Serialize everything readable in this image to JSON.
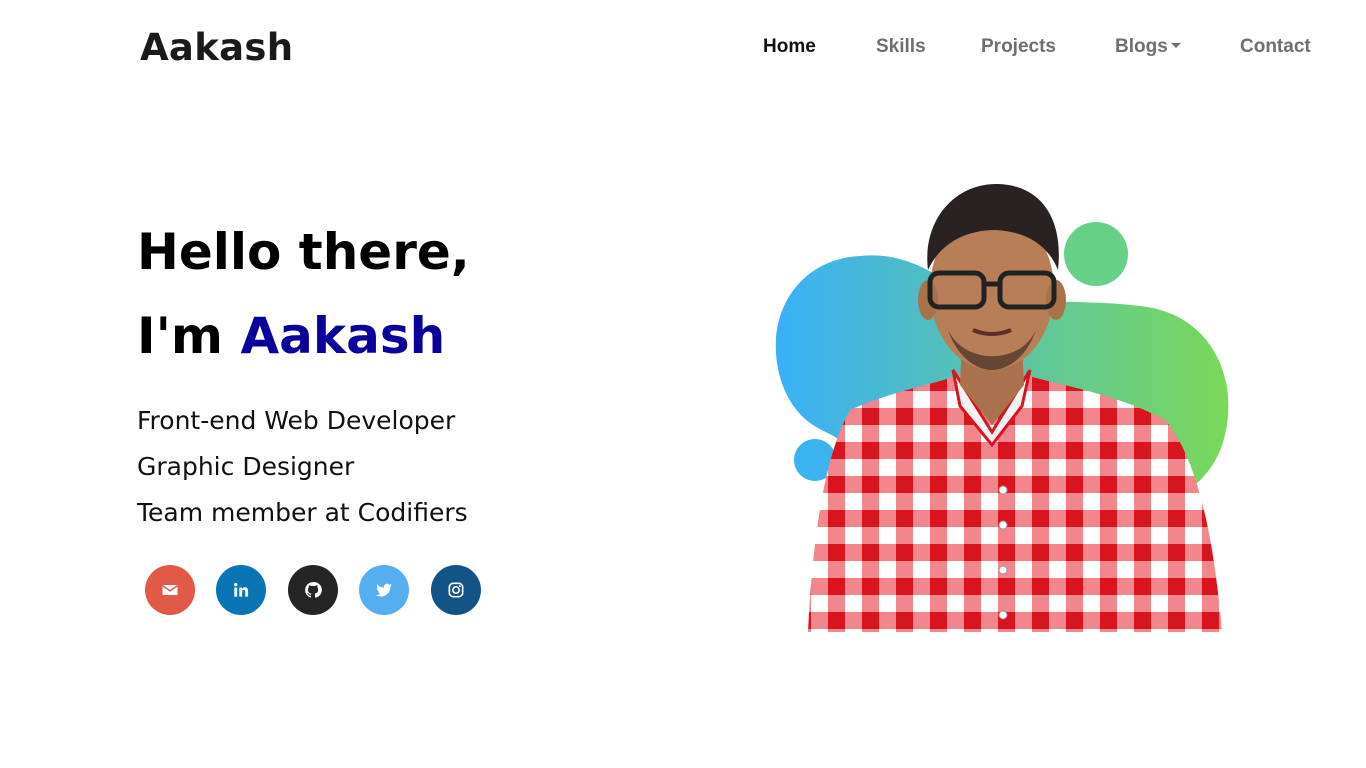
{
  "brand": "Aakash",
  "nav": {
    "items": [
      {
        "label": "Home",
        "active": true
      },
      {
        "label": "Skills"
      },
      {
        "label": "Projects"
      },
      {
        "label": "Blogs",
        "dropdown": true
      },
      {
        "label": "Contact"
      }
    ]
  },
  "hero": {
    "greeting": "Hello there,",
    "intro_prefix": "I'm",
    "name": "Aakash",
    "roles": [
      "Front-end Web Developer",
      "Graphic Designer",
      "Team member at Codifiers"
    ]
  },
  "socials": [
    {
      "icon": "email-icon",
      "color": "#e05a47"
    },
    {
      "icon": "linkedin-icon",
      "color": "#0a74b5"
    },
    {
      "icon": "github-icon",
      "color": "#252525"
    },
    {
      "icon": "twitter-icon",
      "color": "#56aef0"
    },
    {
      "icon": "instagram-icon",
      "color": "#145386"
    }
  ],
  "colors": {
    "name_accent": "#0a009c",
    "nav_active": "#111111",
    "nav_inactive": "#6f6f6f",
    "blob_start": "#3ab0f8",
    "blob_end": "#7ad858",
    "shirt_red": "#e8202e"
  }
}
